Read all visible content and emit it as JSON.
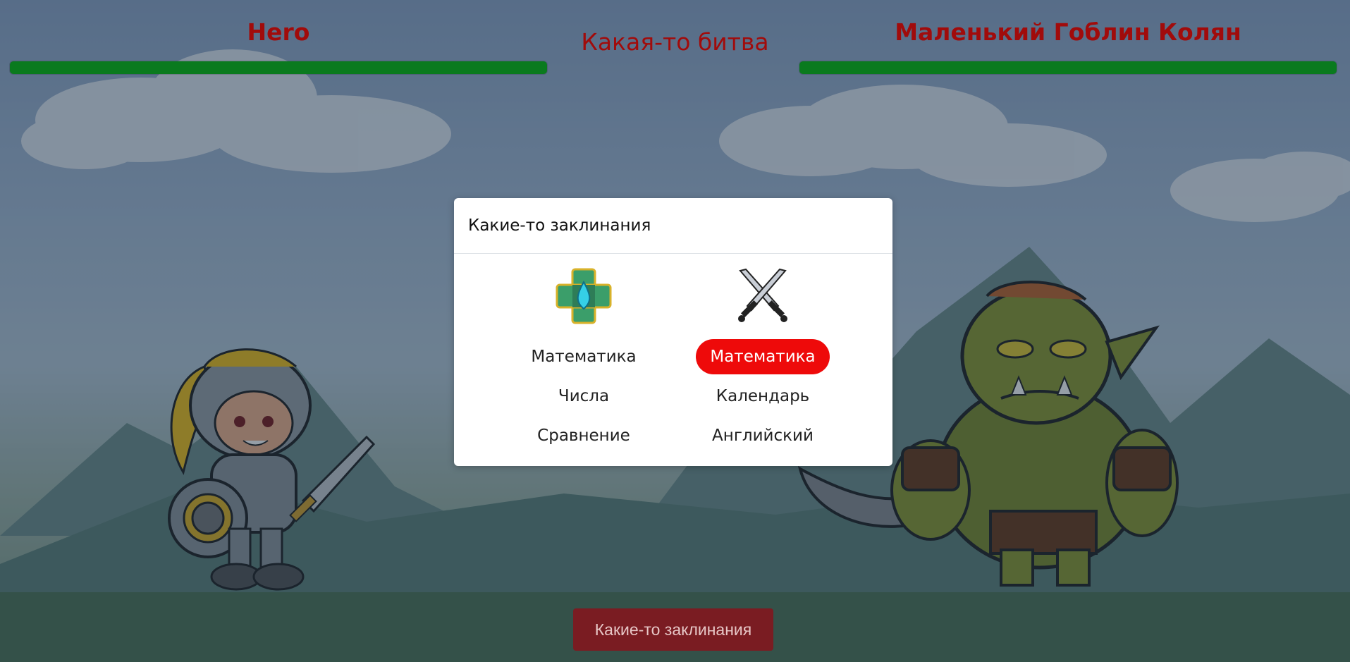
{
  "player": {
    "name": "Hero",
    "hp": 1.0
  },
  "enemy": {
    "name": "Маленький Гоблин Колян",
    "hp": 1.0
  },
  "battle": {
    "title": "Какая-то битва"
  },
  "modal": {
    "title": "Какие-то заклинания",
    "columns": [
      {
        "icon": "water-rune-icon",
        "items": [
          {
            "label": "Математика",
            "active": false
          },
          {
            "label": "Числа",
            "active": false
          },
          {
            "label": "Сравнение",
            "active": false
          }
        ]
      },
      {
        "icon": "crossed-swords-icon",
        "items": [
          {
            "label": "Математика",
            "active": true
          },
          {
            "label": "Календарь",
            "active": false
          },
          {
            "label": "Английский",
            "active": false
          }
        ]
      }
    ]
  },
  "bottom_button": {
    "label": "Какие-то заклинания"
  },
  "colors": {
    "name_text": "#a10b0b",
    "hp_bar": "#0a7a1e",
    "active_spell": "#ee0a0a",
    "bottom_button": "#7a1c22"
  }
}
